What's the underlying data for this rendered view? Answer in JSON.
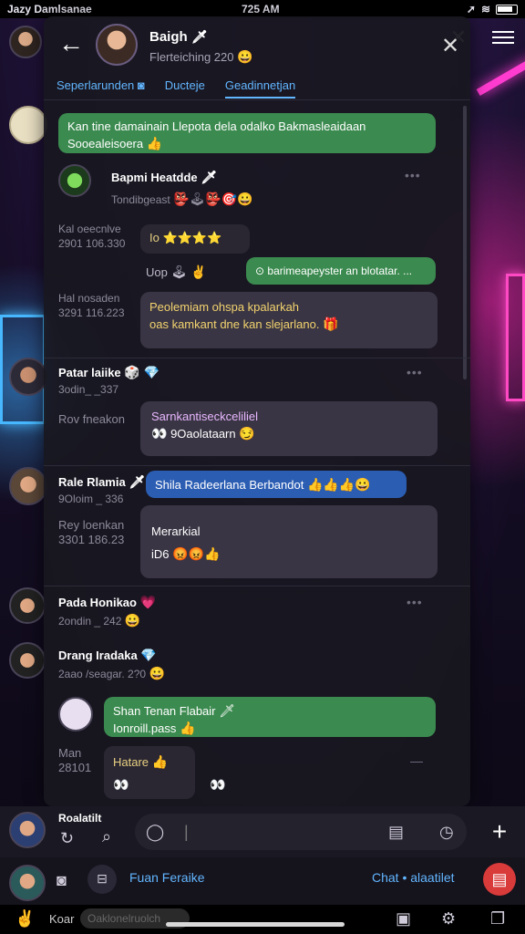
{
  "status": {
    "carrier": "Jazy Damlsanae",
    "time": "725 AM"
  },
  "header": {
    "name": "Baigh",
    "sub": "Flerteiching 220",
    "name_emoji": "🗡"
  },
  "tabs": [
    "Seperlarunden",
    "Ducteje",
    "Geadinnetjan"
  ],
  "messages": {
    "m1": {
      "text": "Kan tine damainain Llepota dela odalko Bakmasleaidaan",
      "sub": "Sooealeisoera"
    },
    "m2": {
      "name": "Bapmi Heatdde",
      "meta": "Tondibgeast",
      "emojis": "👺🕹👺🎯😀"
    },
    "m3": {
      "side": "Kal oeecnlve",
      "side2": "2901 106.330",
      "bubble": "Io ⭐⭐⭐⭐"
    },
    "m4": {
      "side": "Uop",
      "bubble": "⊙ barimeapeyster an blotatar. ..."
    },
    "m5": {
      "side": "Hal nosaden",
      "side2": "3291 116.223",
      "line1": "Peolemiam ohspa kpalarkah",
      "line2": "oas kamkant dne kan slejarlano."
    },
    "m6": {
      "name": "Patar laiike",
      "meta": "3odin_ _337",
      "side": "Rov fneakon",
      "line1": "Sarnkantiseckceliliel",
      "line2": "9Oaolataarn"
    },
    "m7": {
      "name": "Rale Rlamia",
      "meta": "9Oloim _ 336",
      "bubble": "Shila Radeerlana Berbandot"
    },
    "m8": {
      "side": "Rey loenkan",
      "side2": "3301 186.23",
      "line1": "Merarkial",
      "line2": "iD6"
    },
    "m9": {
      "name": "Pada Honikao",
      "meta": "2ondin _ 242"
    },
    "m10": {
      "name": "Drang Iradaka",
      "meta": "2aao /seagar. 2?0"
    },
    "m11": {
      "line1": "Shan Tenan Flabair",
      "line2": "Ionroill.pass"
    },
    "m12": {
      "side": "Man",
      "side2": "28101",
      "bubble": "Hatare"
    }
  },
  "composer": {
    "label": "Roalatilt",
    "placeholder": ""
  },
  "bar2": {
    "left": "Fuan Feraike",
    "right": "Chat • alaatilet"
  },
  "bar3": {
    "left": "Koar",
    "pill": "Oaklonelruolch"
  },
  "colors": {
    "green": "#3b8a4f",
    "blue": "#2b5db3",
    "accent": "#62b6ff"
  }
}
